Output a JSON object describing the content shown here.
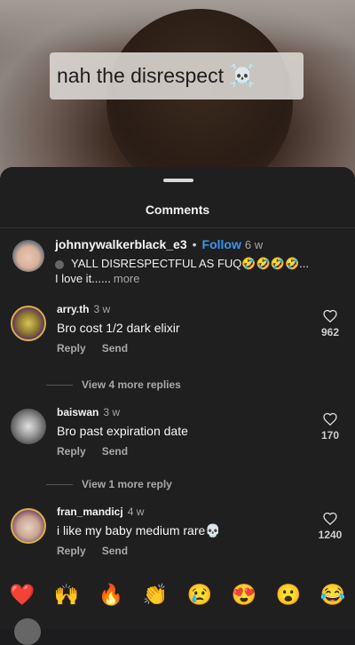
{
  "video": {
    "caption_text": "nah the disrespect",
    "caption_emoji": "☠️"
  },
  "comments_sheet": {
    "title": "Comments",
    "caption": {
      "username": "johnnywalkerblack_e3",
      "follow_label": "Follow",
      "time": "6 w",
      "text_line1": "YALL DISRESPECTFUL AS FUQ🤣🤣🤣🤣...",
      "text_line2": "I love it......",
      "more_label": "more"
    },
    "comments": [
      {
        "username": "arry.th",
        "time": "3 w",
        "text": "Bro cost 1/2 dark elixir",
        "reply_label": "Reply",
        "send_label": "Send",
        "likes": "962",
        "view_replies": "View 4 more replies"
      },
      {
        "username": "baiswan",
        "time": "3 w",
        "text": "Bro past expiration date",
        "reply_label": "Reply",
        "send_label": "Send",
        "likes": "170",
        "view_replies": "View 1 more reply"
      },
      {
        "username": "fran_mandicj",
        "time": "4 w",
        "text": "i like my baby medium rare💀",
        "reply_label": "Reply",
        "send_label": "Send",
        "likes": "1240"
      }
    ],
    "emoji_reactions": [
      "❤️",
      "🙌",
      "🔥",
      "👏",
      "😢",
      "😍",
      "😮",
      "😂"
    ]
  }
}
